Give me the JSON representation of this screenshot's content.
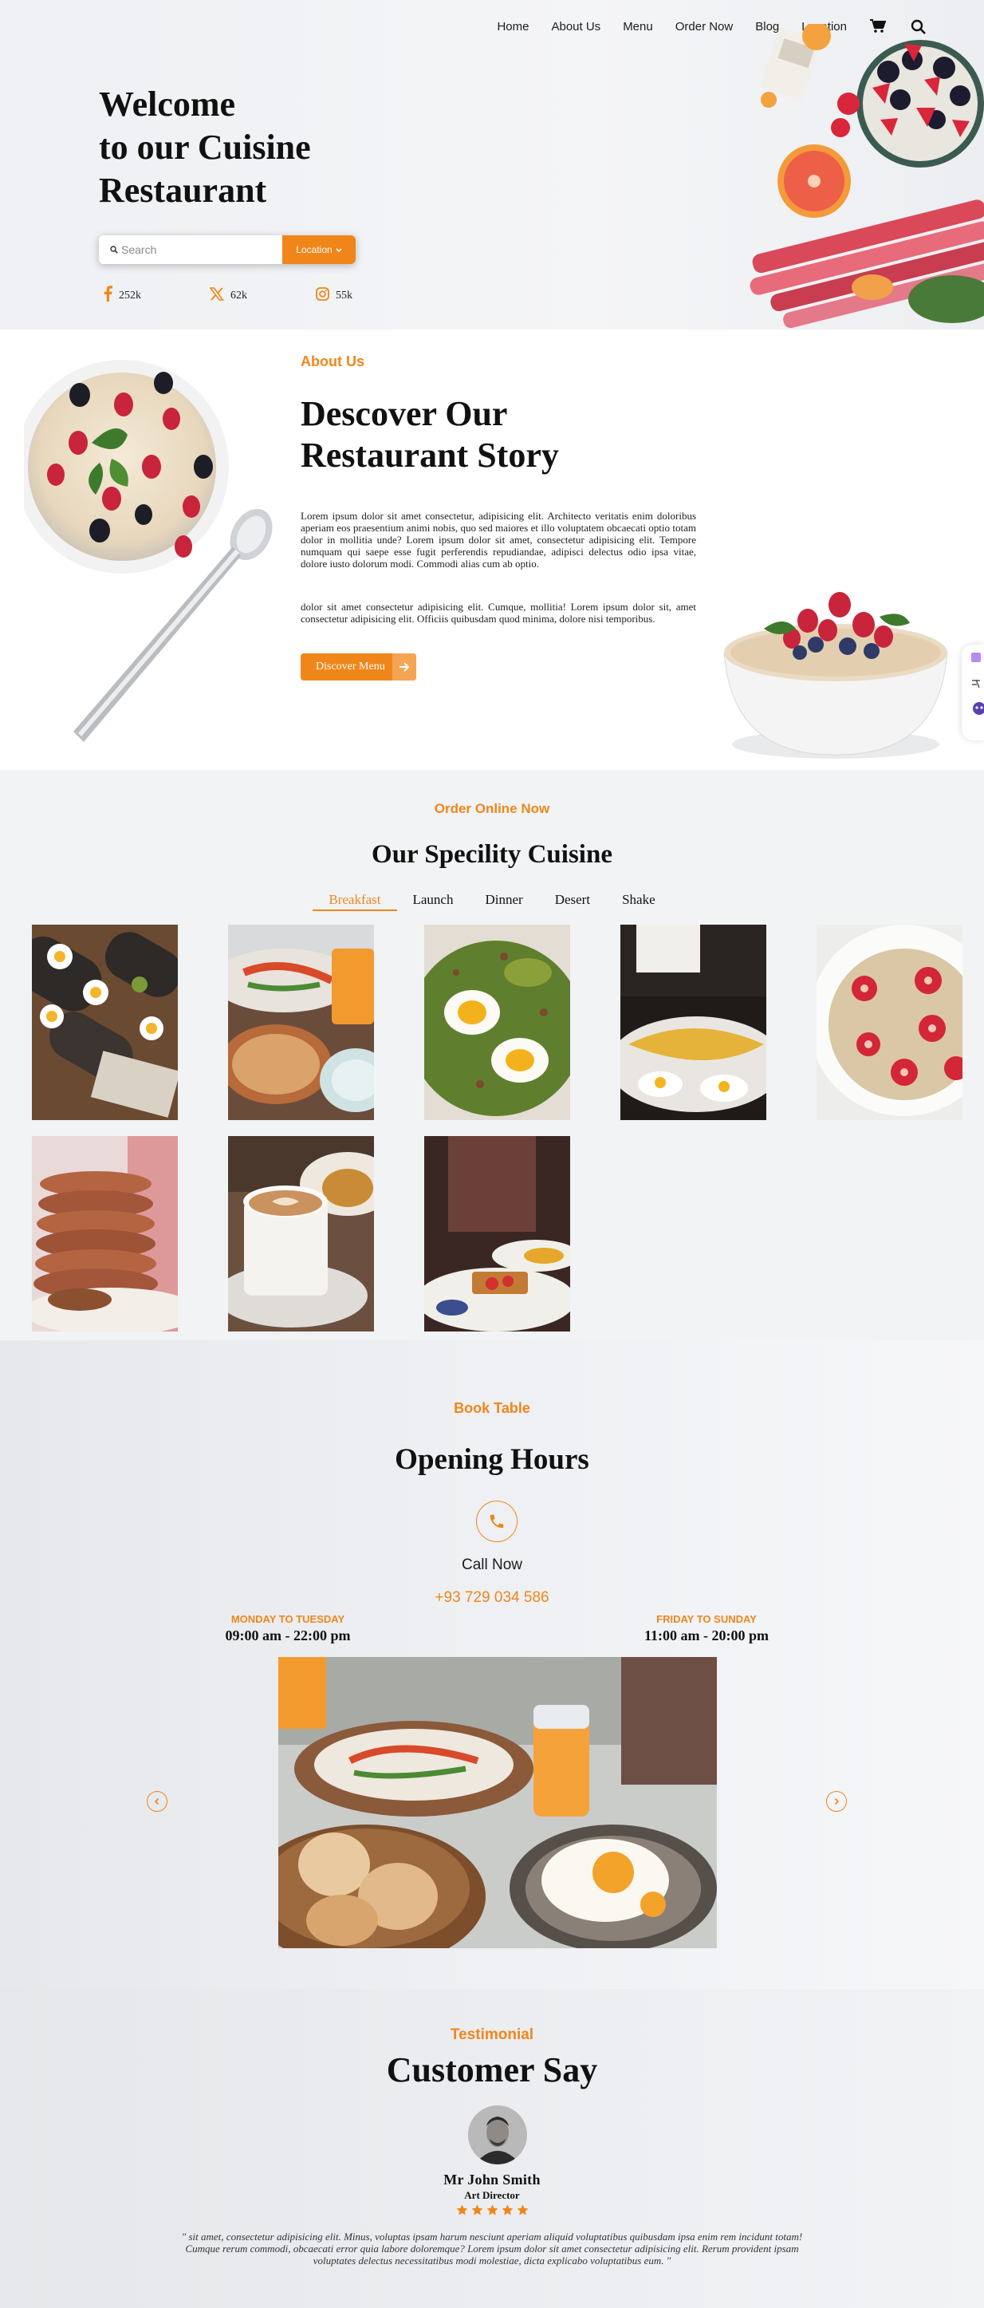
{
  "nav": {
    "links": [
      "Home",
      "About Us",
      "Menu",
      "Order Now",
      "Blog",
      "Location"
    ],
    "icons": [
      "cart-icon",
      "search-icon"
    ]
  },
  "hero": {
    "title_lines": [
      "Welcome",
      "to our Cuisine",
      "Restaurant"
    ],
    "search_placeholder": "Search",
    "location_label": "Location",
    "socials": [
      {
        "icon": "facebook-icon",
        "count": "252k"
      },
      {
        "icon": "x-icon",
        "count": "62k"
      },
      {
        "icon": "instagram-icon",
        "count": "55k"
      }
    ]
  },
  "about": {
    "eyebrow": "About Us",
    "title_lines": [
      "Descover Our",
      "Restaurant Story"
    ],
    "paragraph1": "Lorem ipsum dolor sit amet consectetur, adipisicing elit. Architecto veritatis enim doloribus aperiam eos praesentium animi nobis, quo sed maiores et illo voluptatem obcaecati optio totam dolor in mollitia unde? Lorem ipsum dolor sit amet, consectetur adipisicing elit. Tempore numquam qui saepe esse fugit perferendis repudiandae, adipisci delectus odio ipsa vitae, dolore iusto dolorum modi. Commodi alias cum ab optio.",
    "paragraph2": "dolor sit amet consectetur adipisicing elit. Cumque, mollitia! Lorem ipsum dolor sit, amet consectetur adipisicing elit. Officiis quibusdam quod minima, dolore nisi temporibus.",
    "button_label": "Discover Menu"
  },
  "cuisine": {
    "eyebrow": "Order Online Now",
    "title": "Our Specility Cuisine",
    "tabs": [
      "Breakfast",
      "Launch",
      "Dinner",
      "Desert",
      "Shake"
    ],
    "active_tab": "Breakfast"
  },
  "booking": {
    "eyebrow": "Book Table",
    "title": "Opening Hours",
    "call_label": "Call Now",
    "phone": "+93 729 034 586",
    "weekday_label": "MONDAY TO TUESDAY",
    "weekday_hours": "09:00 am - 22:00 pm",
    "weekend_label": "FRIDAY TO SUNDAY",
    "weekend_hours": "11:00 am - 20:00 pm"
  },
  "testimonial": {
    "eyebrow": "Testimonial",
    "title": "Customer Say",
    "name": "Mr John Smith",
    "role": "Art Director",
    "rating": 5,
    "quote": "\" sit amet, consectetur adipisicing elit. Minus, voluptas ipsam harum nesciunt aperiam aliquid voluptatibus quibusdam ipsa enim rem incidunt totam! Cumque rerum commodi, obcaecati error quia labore doloremque? Lorem ipsum dolor sit amet consectetur adipisicing elit. Rerum provident ipsam voluptates delectus necessitatibus modi molestiae, dicta explicabo voluptatibus eum. \""
  },
  "colors": {
    "accent": "#f0861a",
    "text": "#111111"
  }
}
